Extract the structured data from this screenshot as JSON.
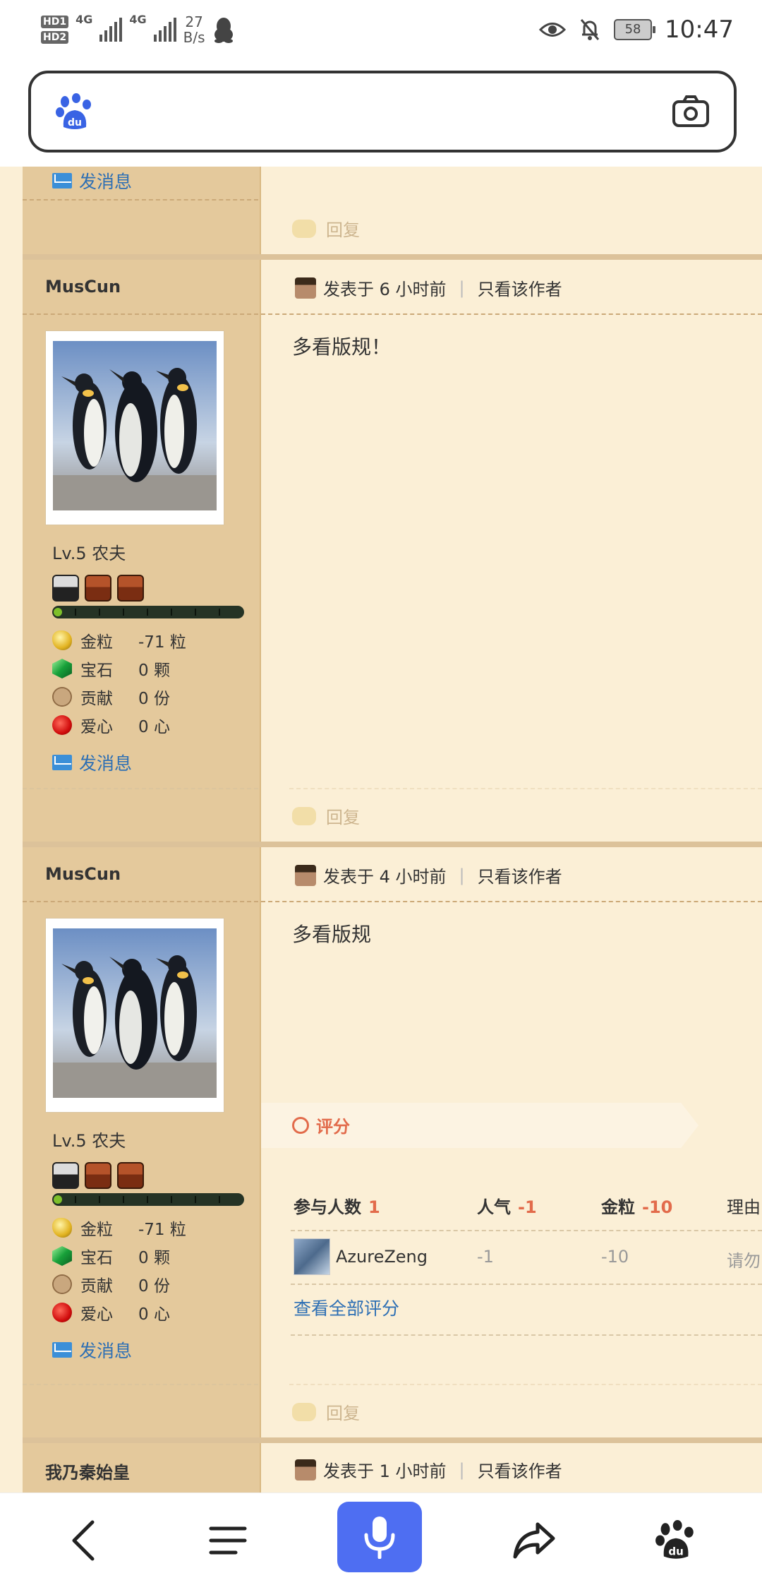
{
  "status_bar": {
    "hd1": "HD1",
    "hd2": "HD2",
    "net1": "4G",
    "net2": "4G",
    "speed_value": "27",
    "speed_unit": "B/s",
    "battery": "58",
    "time": "10:47"
  },
  "search": {
    "logo_text": "du",
    "placeholder": ""
  },
  "prev_post": {
    "send_msg": "发消息",
    "reply": "回复"
  },
  "posts": [
    {
      "author": "MusCun",
      "meta_icon": "steve-head-icon",
      "posted": "发表于 6 小时前",
      "only_author": "只看该作者",
      "content": "多看版规！",
      "level": "Lv.5 农夫",
      "progress": 0.03,
      "stats": [
        {
          "icon": "gold-nugget-icon",
          "label": "金粒",
          "value": "-71 粒"
        },
        {
          "icon": "emerald-icon",
          "label": "宝石",
          "value": "0 颗"
        },
        {
          "icon": "cookie-icon",
          "label": "贡献",
          "value": "0 份"
        },
        {
          "icon": "apple-icon",
          "label": "爱心",
          "value": "0 心"
        }
      ],
      "send_msg": "发消息",
      "reply": "回复"
    },
    {
      "author": "MusCun",
      "meta_icon": "steve-head-icon",
      "posted": "发表于 4 小时前",
      "only_author": "只看该作者",
      "content": "多看版规",
      "level": "Lv.5 农夫",
      "progress": 0.03,
      "stats": [
        {
          "icon": "gold-nugget-icon",
          "label": "金粒",
          "value": "-71 粒"
        },
        {
          "icon": "emerald-icon",
          "label": "宝石",
          "value": "0 颗"
        },
        {
          "icon": "cookie-icon",
          "label": "贡献",
          "value": "0 份"
        },
        {
          "icon": "apple-icon",
          "label": "爱心",
          "value": "0 心"
        }
      ],
      "send_msg": "发消息",
      "reply": "回复",
      "rating": {
        "title": "评分",
        "headers": {
          "participants": "参与人数",
          "participants_value": "1",
          "popularity": "人气",
          "popularity_value": "-1",
          "gold": "金粒",
          "gold_value": "-10",
          "reason": "理由"
        },
        "row": {
          "user": "AzureZeng",
          "popularity": "-1",
          "gold": "-10",
          "reason": "请勿"
        },
        "view_all": "查看全部评分"
      }
    },
    {
      "author": "我乃秦始皇",
      "meta_icon": "steve-head-icon",
      "posted": "发表于 1 小时前",
      "only_author": "只看该作者"
    }
  ],
  "colors": {
    "page_bg": "#fbefd6",
    "sidebar_bg": "#e4c99c",
    "link": "#2d6fb4",
    "accent_red": "#e26b4b",
    "mic_blue": "#4e6ef2"
  }
}
